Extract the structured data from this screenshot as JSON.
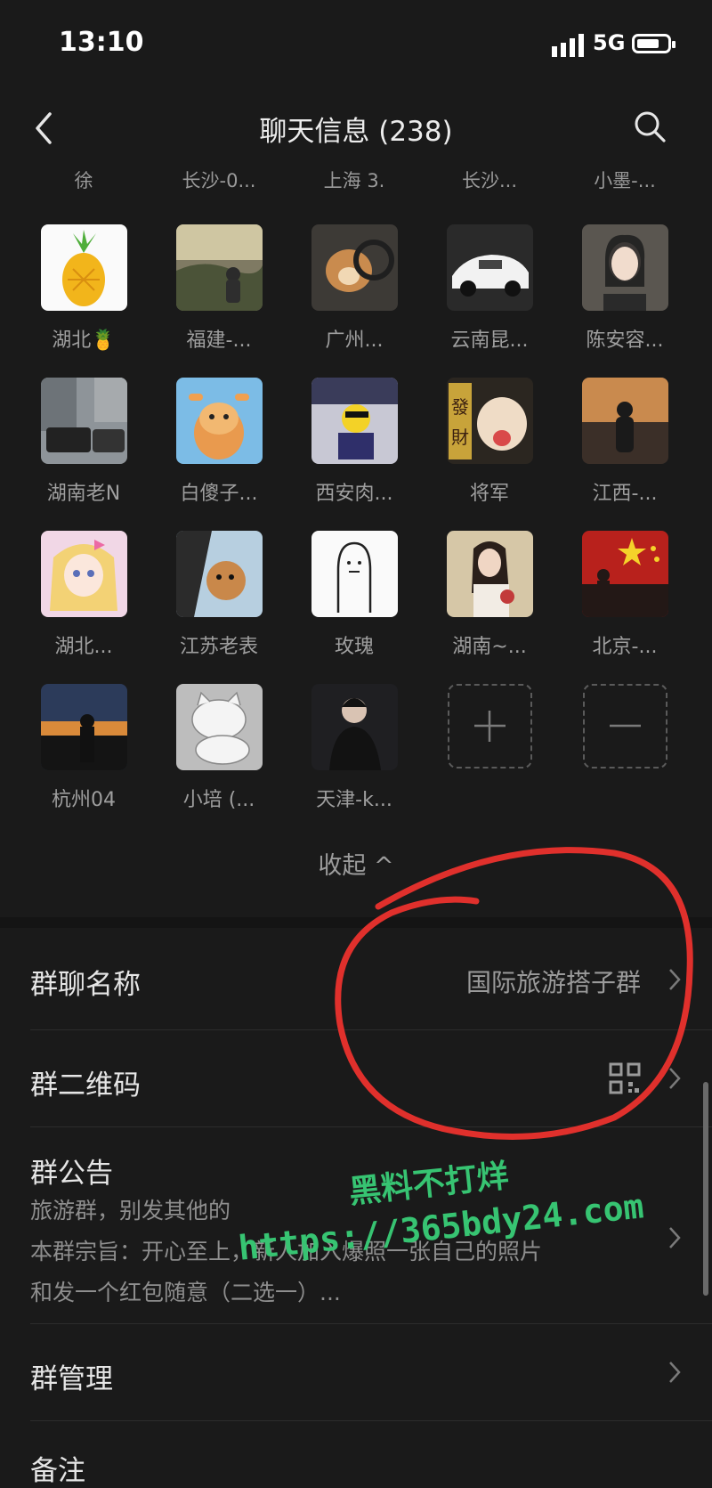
{
  "status": {
    "time": "13:10",
    "network": "5G"
  },
  "nav": {
    "title": "聊天信息 (238)"
  },
  "top_row": [
    "徐",
    "长沙-0...",
    "上海 3.",
    "长沙...",
    "小墨-..."
  ],
  "members": [
    "湖北🍍",
    "福建-...",
    "广州...",
    "云南昆...",
    "陈安容...",
    "湖南老N",
    "白傻子...",
    "西安肉...",
    "将军",
    "江西-...",
    "湖北...",
    "江苏老表",
    "玫瑰",
    "湖南~...",
    "北京-...",
    "杭州04",
    "小培 (...",
    "天津-k..."
  ],
  "controls": {
    "add": "+",
    "remove": "—"
  },
  "collapse_label": "收起 ^",
  "settings": {
    "group_name_label": "群聊名称",
    "group_name_value": "国际旅游搭子群",
    "qr_label": "群二维码",
    "announcement_label": "群公告",
    "announcement_lines": [
      "旅游群，别发其他的",
      "本群宗旨：开心至上，新人加入爆照一张自己的照片",
      "和发一个红包随意（二选一）..."
    ],
    "manage_label": "群管理",
    "remark_label": "备注"
  },
  "watermark": {
    "line1": "黑料不打烊",
    "line2": "https://365bdy24.com"
  },
  "colors": {
    "background": "#1a1a1a",
    "annotation_circle": "#e0302c",
    "watermark": "#37c472"
  }
}
